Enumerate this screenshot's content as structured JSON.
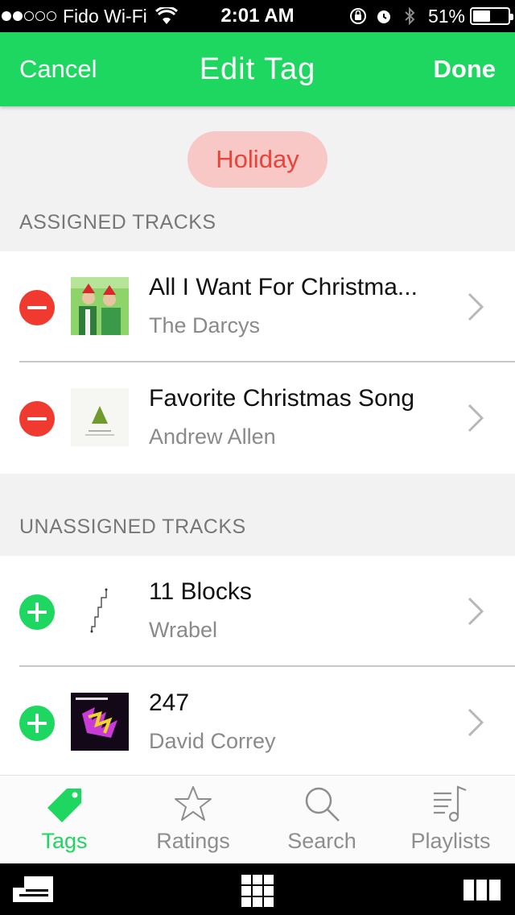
{
  "status_bar": {
    "carrier": "Fido Wi-Fi",
    "time": "2:01 AM",
    "battery": "51%",
    "battery_level": 0.51,
    "signal_dots_filled": 2,
    "signal_dots_total": 5,
    "icons": [
      "wifi-icon",
      "orientation-lock-icon",
      "alarm-icon",
      "bluetooth-icon",
      "battery-icon"
    ]
  },
  "nav": {
    "cancel_label": "Cancel",
    "title": "Edit Tag",
    "done_label": "Done"
  },
  "tag": {
    "name": "Holiday",
    "color": "#e9433a",
    "bg_color": "#f8c8c6"
  },
  "assigned": {
    "header": "ASSIGNED TRACKS",
    "tracks": [
      {
        "title": "All I Want For Christma...",
        "artist": "The Darcys",
        "action": "remove"
      },
      {
        "title": "Favorite Christmas Song",
        "artist": "Andrew Allen",
        "action": "remove"
      }
    ]
  },
  "unassigned": {
    "header": "UNASSIGNED TRACKS",
    "tracks": [
      {
        "title": "11 Blocks",
        "artist": "Wrabel",
        "action": "add"
      },
      {
        "title": "247",
        "artist": "David Correy",
        "action": "add"
      }
    ]
  },
  "tabs": [
    {
      "label": "Tags",
      "icon": "tag-icon",
      "active": true
    },
    {
      "label": "Ratings",
      "icon": "star-icon",
      "active": false
    },
    {
      "label": "Search",
      "icon": "search-icon",
      "active": false
    },
    {
      "label": "Playlists",
      "icon": "playlist-icon",
      "active": false
    }
  ],
  "colors": {
    "accent": "#1ed760",
    "remove": "#f0392f",
    "secondary_text": "#8a8a8a"
  }
}
